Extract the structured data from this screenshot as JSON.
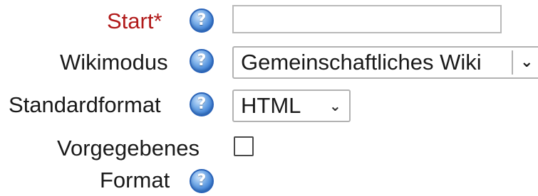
{
  "form": {
    "start": {
      "label": "Start",
      "required_marker": "*",
      "value": ""
    },
    "wiki_mode": {
      "label": "Wikimodus",
      "selected": "Gemeinschaftliches Wiki",
      "arrow_icon": "chevron-down-icon"
    },
    "default_format": {
      "label": "Standardformat",
      "selected": "HTML",
      "arrow_icon": "chevron-down-icon"
    },
    "forced_format": {
      "label_line1": "Vorgegebenes",
      "label_line2": "Format",
      "checked": false
    },
    "help_icon": {
      "name": "help-icon",
      "glyph": "?",
      "color": "#3d7fd4"
    },
    "colors": {
      "required_label": "#b11a1a",
      "text": "#1a1a1a",
      "input_border": "#b9b9b9"
    }
  }
}
